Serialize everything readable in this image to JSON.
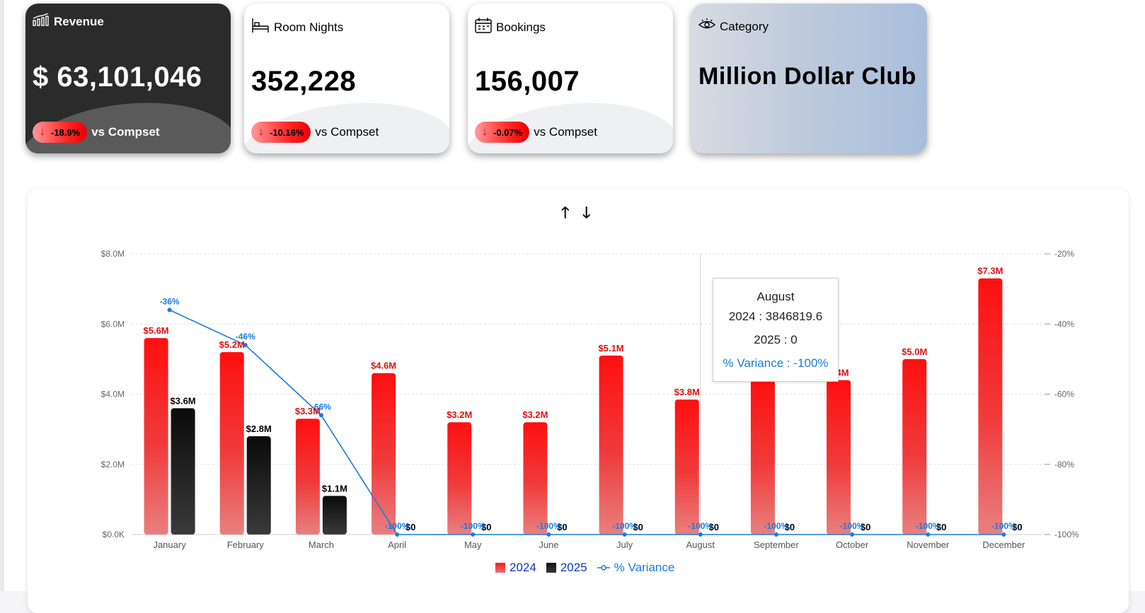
{
  "kpis": {
    "revenue": {
      "title": "Revenue",
      "value": "$ 63,101,046",
      "badge": "-18.9%",
      "compare": "vs Compset"
    },
    "room_nights": {
      "title": "Room Nights",
      "value": "352,228",
      "badge": "-10.16%",
      "compare": "vs Compset"
    },
    "bookings": {
      "title": "Bookings",
      "value": "156,007",
      "badge": "-0.07%",
      "compare": "vs Compset"
    },
    "category": {
      "title": "Category",
      "value": "Million Dollar Club"
    }
  },
  "sort": {
    "up": "🡑",
    "down": "🡓"
  },
  "tooltip": {
    "month": "August",
    "line_2024": "2024 : 3846819.6",
    "line_2025": "2025 : 0",
    "line_var": "% Variance : -100%"
  },
  "legend": {
    "s2024": "2024",
    "s2025": "2025",
    "variance": "% Variance"
  },
  "colors": {
    "red": "#ff1a1a",
    "black": "#111111",
    "blue": "#1a7be0"
  },
  "chart_data": {
    "type": "bar",
    "categories": [
      "January",
      "February",
      "March",
      "April",
      "May",
      "June",
      "July",
      "August",
      "September",
      "October",
      "November",
      "December"
    ],
    "series": [
      {
        "name": "2024",
        "values": [
          5.6,
          5.2,
          3.3,
          4.6,
          3.2,
          3.2,
          5.1,
          3.846819,
          4.4,
          4.4,
          5.0,
          7.3
        ],
        "labels": [
          "$5.6M",
          "$5.2M",
          "$3.3M",
          "$4.6M",
          "$3.2M",
          "$3.2M",
          "$5.1M",
          "$3.8M",
          "",
          "4.4M",
          "$5.0M",
          "$7.3M"
        ]
      },
      {
        "name": "2025",
        "values": [
          3.6,
          2.8,
          1.1,
          0,
          0,
          0,
          0,
          0,
          0,
          0,
          0,
          0
        ],
        "labels": [
          "$3.6M",
          "$2.8M",
          "$1.1M",
          "$0",
          "$0",
          "$0",
          "$0",
          "$0",
          "$0",
          "$0",
          "$0",
          "$0"
        ]
      },
      {
        "name": "% Variance",
        "axis": "right",
        "values": [
          -36,
          -46,
          -66,
          -100,
          -100,
          -100,
          -100,
          -100,
          -100,
          -100,
          -100,
          -100
        ],
        "labels": [
          "-36%",
          "-46%",
          "-66%",
          "-100%",
          "-100%",
          "-100%",
          "-100%",
          "-100%",
          "-100%",
          "-100%",
          "-100%",
          "-100%"
        ]
      }
    ],
    "y_left": {
      "min": 0,
      "max": 8,
      "ticks": [
        "$0.0K",
        "$2.0M",
        "$4.0M",
        "$6.0M",
        "$8.0M"
      ]
    },
    "y_right": {
      "min": -100,
      "max": -20,
      "ticks": [
        "-100%",
        "-80%",
        "-60%",
        "-40%",
        "-20%"
      ]
    },
    "grid": true,
    "legend_position": "bottom-center"
  }
}
